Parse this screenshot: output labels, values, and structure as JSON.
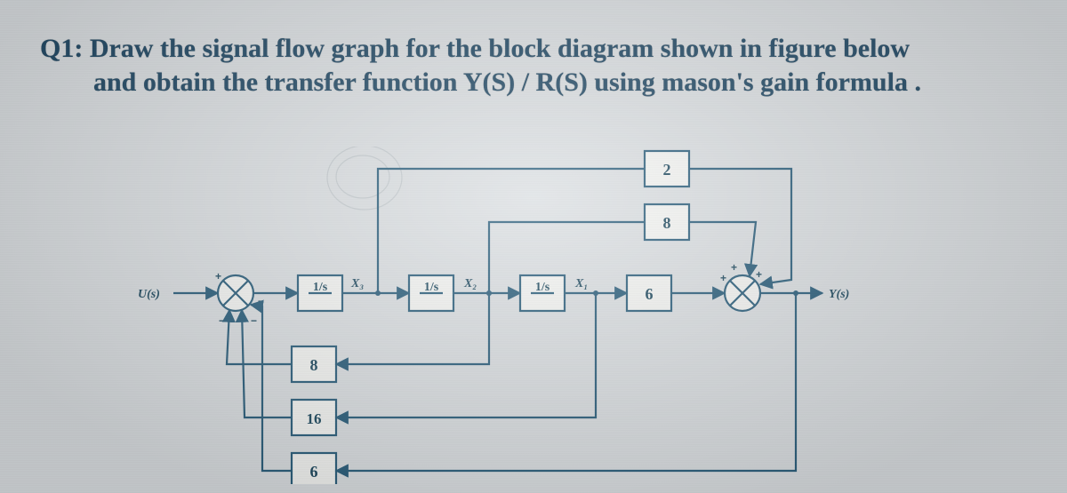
{
  "question": {
    "line1": "Q1: Draw the signal flow graph for the block diagram shown in figure below",
    "line2": "and obtain the transfer function Y(S) / R(S) using mason's gain formula ."
  },
  "labels": {
    "input": "U(s)",
    "output": "Y(s)",
    "x3": "X₃",
    "x2": "X₂",
    "x1": "X₁"
  },
  "blocks": {
    "g1": "1/s",
    "g2": "1/s",
    "g3": "1/s",
    "g4": "6",
    "ff_top": "2",
    "ff_mid": "8",
    "fb1": "8",
    "fb2": "16",
    "fb3": "6"
  },
  "signs": {
    "sum1_in": "+",
    "sum1_fb1": "−",
    "sum1_fb2": "−",
    "sum1_fb3": "−",
    "sum2_a": "+",
    "sum2_b": "+",
    "sum2_c": "+"
  }
}
